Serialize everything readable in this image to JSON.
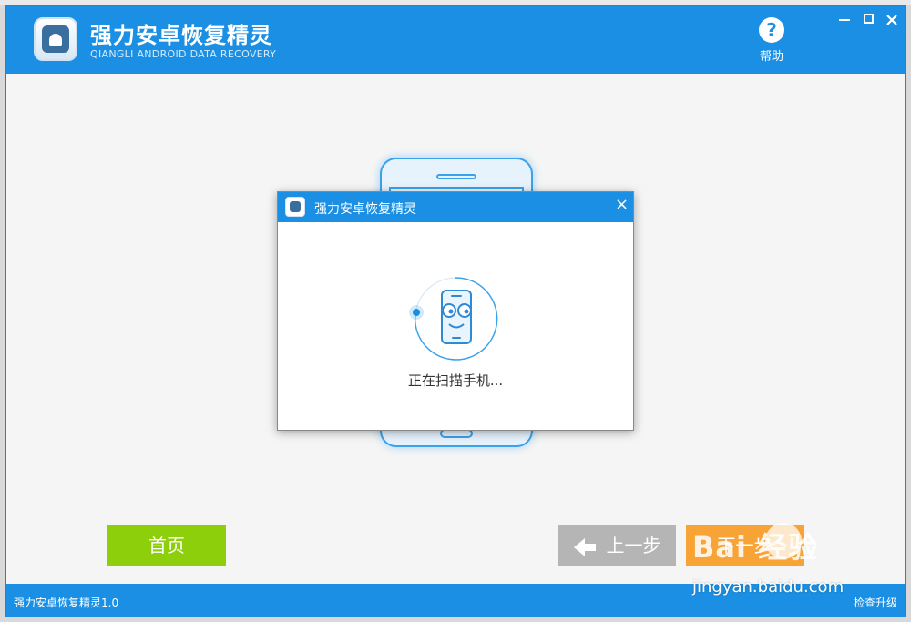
{
  "app": {
    "title": "强力安卓恢复精灵",
    "subtitle": "QIANGLI ANDROID DATA RECOVERY",
    "help_label": "帮助"
  },
  "window_controls": {
    "minimize": "–",
    "maximize": "□",
    "close": "✕"
  },
  "dialog": {
    "title": "强力安卓恢复精灵",
    "close": "×",
    "status": "正在扫描手机..."
  },
  "buttons": {
    "home": "首页",
    "prev": "上一步",
    "next": "下一步"
  },
  "footer": {
    "version": "强力安卓恢复精灵1.0",
    "update": "检查升级"
  },
  "watermark": {
    "brand": "Bai  经验",
    "url": "jingyan.baidu.com"
  },
  "colors": {
    "primary": "#1a8fe3",
    "home_button": "#8dcf0a",
    "prev_button": "#b5b5b5",
    "next_button": "#f7a336"
  }
}
